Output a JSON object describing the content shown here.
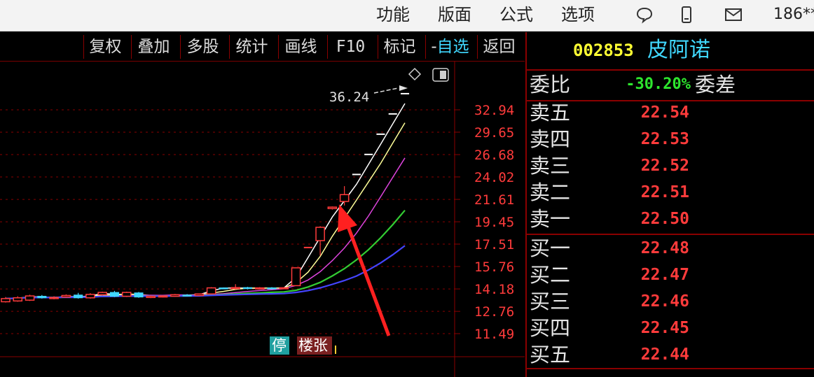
{
  "menu": {
    "items": [
      "功能",
      "版面",
      "公式",
      "选项"
    ],
    "user": "186**"
  },
  "toolbar": {
    "buttons": [
      "复权",
      "叠加",
      "多股",
      "统计",
      "画线",
      "F10",
      "标记",
      "返回"
    ],
    "watchlist_prefix": "-",
    "watchlist_label": "自选"
  },
  "stock": {
    "code": "002853",
    "name": "皮阿诺"
  },
  "quote": {
    "weibi_label": "委比",
    "weibi_value": "-30.20%",
    "weicha_label": "委差",
    "sell": [
      {
        "label": "卖五",
        "price": "22.54"
      },
      {
        "label": "卖四",
        "price": "22.53"
      },
      {
        "label": "卖三",
        "price": "22.52"
      },
      {
        "label": "卖二",
        "price": "22.51"
      },
      {
        "label": "卖一",
        "price": "22.50"
      }
    ],
    "buy": [
      {
        "label": "买一",
        "price": "22.48"
      },
      {
        "label": "买二",
        "price": "22.47"
      },
      {
        "label": "买三",
        "price": "22.46"
      },
      {
        "label": "买四",
        "price": "22.45"
      },
      {
        "label": "买五",
        "price": "22.44"
      }
    ]
  },
  "chart_data": {
    "type": "candlestick",
    "y_ticks": [
      "32.94",
      "29.65",
      "26.68",
      "24.02",
      "21.61",
      "19.45",
      "17.51",
      "15.76",
      "14.18",
      "12.76",
      "11.49"
    ],
    "log_scale": true,
    "max_label": "36.24",
    "badges": [
      "停",
      "楼张"
    ],
    "colors": {
      "up": "#ff3b3b",
      "down": "#40d8ff",
      "ma1": "#ffffff",
      "ma2": "#ffff99",
      "ma3": "#dd44dd",
      "ma4": "#33cc33",
      "ma5": "#4444ff",
      "grid": "#8a0000",
      "arrow": "#ff2020"
    },
    "candles": [
      {
        "o": 13.35,
        "c": 13.55,
        "h": 13.65,
        "l": 13.3
      },
      {
        "o": 13.4,
        "c": 13.6,
        "h": 13.7,
        "l": 13.35
      },
      {
        "o": 13.45,
        "c": 13.72,
        "h": 13.8,
        "l": 13.4
      },
      {
        "o": 13.7,
        "c": 13.6,
        "h": 13.78,
        "l": 13.55
      },
      {
        "o": 13.55,
        "c": 13.62,
        "h": 13.7,
        "l": 13.5
      },
      {
        "o": 13.65,
        "c": 13.75,
        "h": 13.82,
        "l": 13.6
      },
      {
        "o": 13.78,
        "c": 13.6,
        "h": 13.92,
        "l": 13.55
      },
      {
        "o": 13.6,
        "c": 13.82,
        "h": 13.9,
        "l": 13.55
      },
      {
        "o": 13.8,
        "c": 13.95,
        "h": 14.0,
        "l": 13.75
      },
      {
        "o": 13.95,
        "c": 13.7,
        "h": 14.05,
        "l": 13.65
      },
      {
        "o": 13.7,
        "c": 13.95,
        "h": 14.0,
        "l": 13.65
      },
      {
        "o": 13.92,
        "c": 13.65,
        "h": 13.98,
        "l": 13.6
      },
      {
        "o": 13.62,
        "c": 13.7,
        "h": 13.75,
        "l": 13.58
      },
      {
        "o": 13.68,
        "c": 13.72,
        "h": 13.76,
        "l": 13.62
      },
      {
        "o": 13.7,
        "c": 13.8,
        "h": 13.85,
        "l": 13.66
      },
      {
        "o": 13.78,
        "c": 13.75,
        "h": 13.84,
        "l": 13.7
      },
      {
        "o": 13.75,
        "c": 13.85,
        "h": 13.88,
        "l": 13.72
      },
      {
        "o": 13.85,
        "c": 14.25,
        "h": 14.3,
        "l": 13.82
      },
      {
        "o": 14.25,
        "c": 14.22,
        "h": 14.28,
        "l": 14.18
      },
      {
        "o": 14.22,
        "c": 14.27,
        "h": 14.5,
        "l": 14.15
      },
      {
        "o": 14.27,
        "c": 14.2,
        "h": 14.32,
        "l": 14.15
      },
      {
        "o": 14.2,
        "c": 14.25,
        "h": 14.3,
        "l": 14.16
      },
      {
        "o": 14.25,
        "c": 14.23,
        "h": 14.3,
        "l": 14.2
      },
      {
        "o": 14.23,
        "c": 14.26,
        "h": 14.3,
        "l": 14.2
      },
      {
        "o": 14.4,
        "c": 15.66,
        "h": 15.66,
        "l": 14.4
      },
      {
        "o": 17.23,
        "c": 17.23,
        "h": 17.23,
        "l": 17.23
      },
      {
        "o": 17.8,
        "c": 18.95,
        "h": 19.05,
        "l": 16.6
      },
      {
        "o": 20.7,
        "c": 20.84,
        "h": 20.9,
        "l": 20.6
      },
      {
        "o": 21.4,
        "c": 22.1,
        "h": 23.0,
        "l": 21.0
      },
      {
        "o": 24.3,
        "c": 24.3,
        "h": 24.3,
        "l": 24.3
      },
      {
        "o": 26.7,
        "c": 26.7,
        "h": 26.7,
        "l": 26.7
      },
      {
        "o": 29.37,
        "c": 29.37,
        "h": 29.37,
        "l": 29.37
      },
      {
        "o": 32.31,
        "c": 32.31,
        "h": 32.31,
        "l": 32.31
      },
      {
        "o": 35.54,
        "c": 35.54,
        "h": 35.54,
        "l": 35.54
      }
    ]
  }
}
